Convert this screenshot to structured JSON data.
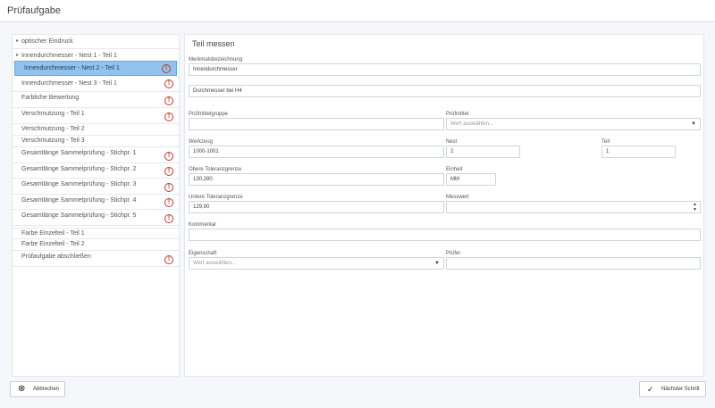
{
  "window": {
    "title": "Prüfaufgabe"
  },
  "sidebar": {
    "items": [
      {
        "label": "optischer Eindruck",
        "bullet": "▸"
      },
      {
        "label": "Innendurchmesser - Nest 1 - Teil 1",
        "bullet": "▸"
      },
      {
        "label": "Innendurchmesser - Nest 2 - Teil 1",
        "warn": "!",
        "active": true
      },
      {
        "label": "Innendurchmesser - Nest 3 - Teil 1",
        "warn": "!"
      },
      {
        "label": "Farbliche Bewertung",
        "warn": "!"
      },
      {
        "label": "Verschmutzung - Teil 1",
        "warn": "!"
      },
      {
        "label": "Verschmutzung - Teil 2"
      },
      {
        "label": "Verschmutzung - Teil 3"
      },
      {
        "label": "Gesamtlänge Sammelprüfung - Stichpr. 1",
        "warn": "!"
      },
      {
        "label": "Gesamtlänge Sammelprüfung - Stichpr. 2",
        "warn": "!"
      },
      {
        "label": "Gesamtlänge Sammelprüfung - Stichpr. 3",
        "warn": "!"
      },
      {
        "label": "Gesamtlänge Sammelprüfung - Stichpr. 4",
        "warn": "!"
      },
      {
        "label": "Gesamtlänge Sammelprüfung - Stichpr. 5",
        "warn": "!"
      },
      {
        "label": "Farbe Einzelteil - Teil 1"
      },
      {
        "label": "Farbe Einzelteil - Teil 2"
      },
      {
        "label": "Prüfaufgabe abschließen",
        "warn": "!"
      }
    ]
  },
  "form": {
    "title": "Teil messen",
    "merkmal": {
      "label": "Merkmalsbezeichnung",
      "value": "Innendurchmesser"
    },
    "merkmal2": {
      "value": "Durchmesser bei H4"
    },
    "pruefmittelgruppe": {
      "label": "Prüfmittelgruppe",
      "value": ""
    },
    "pruefmittel": {
      "label": "Prüfmittel",
      "placeholder": "Wert auswählen..."
    },
    "werkzeug": {
      "label": "Werkzeug",
      "value": "1000-1001"
    },
    "nest": {
      "label": "Nest",
      "value": "2"
    },
    "teil": {
      "label": "Teil",
      "value": "1"
    },
    "obere": {
      "label": "Obere Toleranzgrenze",
      "value": "130,280"
    },
    "einheit": {
      "label": "Einheit",
      "value": "MM"
    },
    "untere": {
      "label": "Untere Toleranzgrenze",
      "value": "129,90"
    },
    "messwert": {
      "label": "Messwert",
      "value": ""
    },
    "kommentar": {
      "label": "Kommentar",
      "value": ""
    },
    "eigenschaft": {
      "label": "Eigenschaft",
      "placeholder": "Wert auswählen..."
    },
    "pruefer": {
      "label": "Prüfer",
      "value": ""
    }
  },
  "footer": {
    "cancel_label": "Abbrechen",
    "next_label": "Nächster Schritt"
  },
  "icons": {
    "cancel": "cancel-circle-icon",
    "next": "checkmark-icon",
    "warning": "warning-circle-icon",
    "dropdown": "chevron-down-icon"
  },
  "colors": {
    "active_item": "#90c3ef",
    "warning": "#c0392b"
  }
}
